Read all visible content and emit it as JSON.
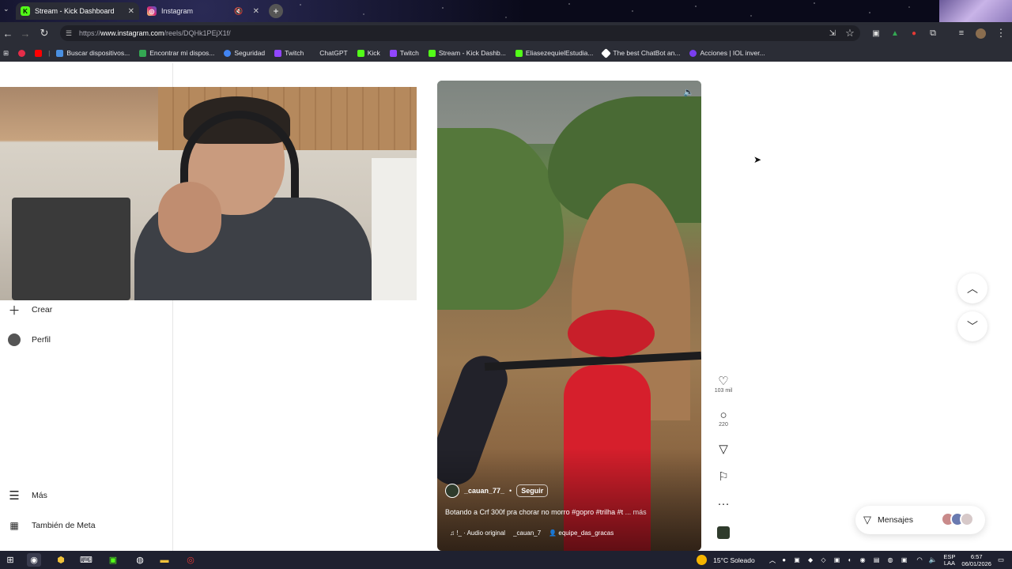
{
  "browser": {
    "tabs": [
      {
        "title": "Stream - Kick Dashboard",
        "favicon": "K",
        "color": "#53fc18",
        "active": true
      },
      {
        "title": "Instagram",
        "favicon": "ig",
        "color": "#e1306c",
        "active": false
      }
    ],
    "url_prefix": "https://",
    "url_host": "www.instagram.com",
    "url_path": "/reels/DQHk1PEjX1f/"
  },
  "bookmarks": [
    {
      "label": "",
      "color": "#e52d49"
    },
    {
      "label": "",
      "color": "#ff0000"
    },
    {
      "label": "Buscar dispositivos...",
      "color": "#4a90e2"
    },
    {
      "label": "Encontrar mi dispos...",
      "color": "#34a853"
    },
    {
      "label": "Seguridad",
      "color": "#4285f4"
    },
    {
      "label": "Twitch",
      "color": "#9146ff"
    },
    {
      "label": "ChatGPT",
      "color": "#2b2d36"
    },
    {
      "label": "Kick",
      "color": "#53fc18"
    },
    {
      "label": "Twitch",
      "color": "#9146ff"
    },
    {
      "label": "Stream - Kick Dashb...",
      "color": "#53fc18"
    },
    {
      "label": "EliasezequielEstudia...",
      "color": "#53fc18"
    },
    {
      "label": "The best ChatBot an...",
      "color": "#ffffff"
    },
    {
      "label": "Acciones | IOL inver...",
      "color": "#7a3ef0"
    }
  ],
  "sidebar": {
    "create_label": "Crear",
    "profile_label": "Perfil",
    "more_label": "Más",
    "meta_label": "También de Meta"
  },
  "reel": {
    "author": "_cauan_77_",
    "follow_label": "Seguir",
    "caption": "Botando a Crf 300f pra chorar no morro #gopro #trilha #t",
    "caption_more": "... más",
    "audio_label": "Audio original",
    "audio_prefix": "!_",
    "audio_author": "_cauan_7",
    "collab": "equipe_das_gracas"
  },
  "actions": {
    "likes": "103 mil",
    "comments": "220"
  },
  "messages": {
    "label": "Mensajes"
  },
  "taskbar": {
    "weather": "15°C  Soleado",
    "lang_top": "ESP",
    "lang_bottom": "LAA",
    "time": "6:57",
    "date": "06/01/2026"
  }
}
